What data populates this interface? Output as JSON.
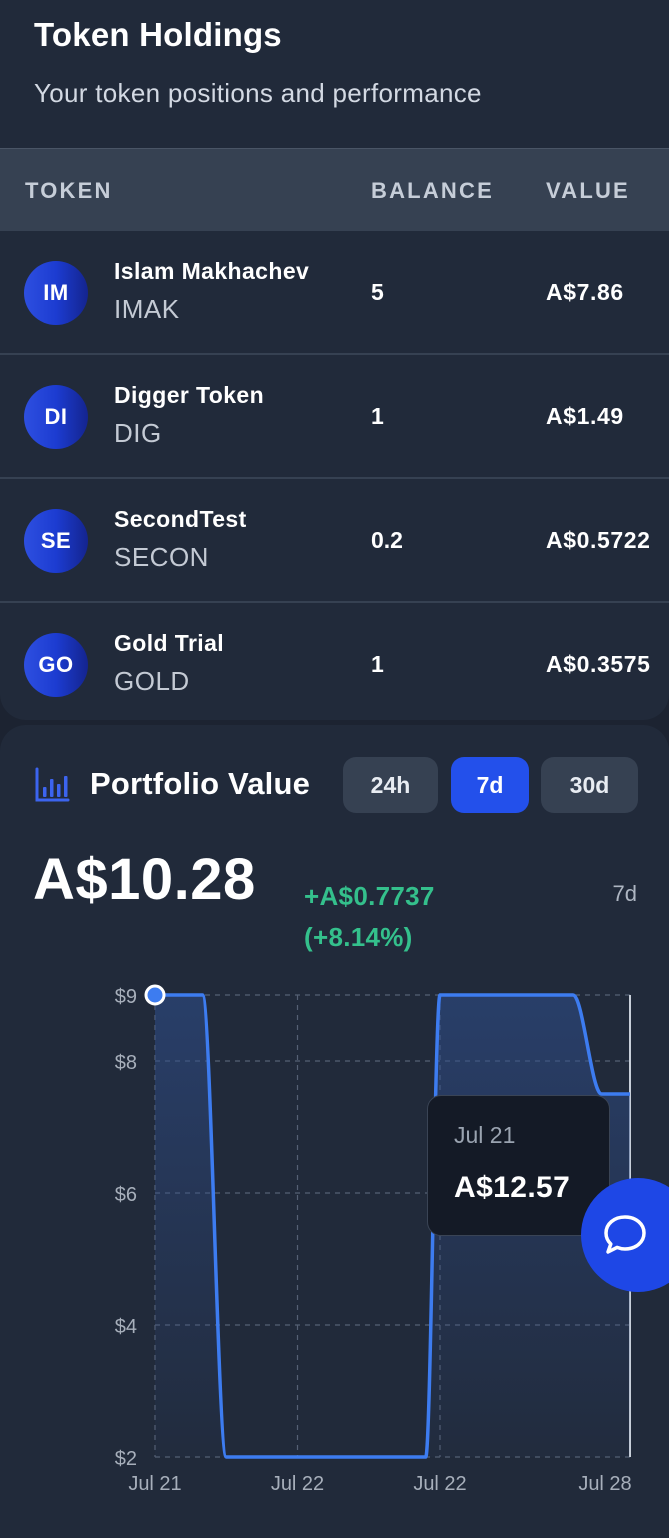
{
  "header": {
    "title": "Token Holdings",
    "subtitle": "Your token positions and performance"
  },
  "table": {
    "columns": {
      "token": "TOKEN",
      "balance": "BALANCE",
      "value": "VALUE"
    },
    "rows": [
      {
        "initials": "IM",
        "name": "Islam Makhachev",
        "symbol": "IMAK",
        "balance": "5",
        "value": "A$7.86"
      },
      {
        "initials": "DI",
        "name": "Digger Token",
        "symbol": "DIG",
        "balance": "1",
        "value": "A$1.49"
      },
      {
        "initials": "SE",
        "name": "SecondTest",
        "symbol": "SECON",
        "balance": "0.2",
        "value": "A$0.5722"
      },
      {
        "initials": "GO",
        "name": "Gold Trial",
        "symbol": "GOLD",
        "balance": "1",
        "value": "A$0.3575"
      }
    ]
  },
  "portfolio": {
    "title": "Portfolio Value",
    "icon": "bar-chart-icon",
    "ranges": [
      "24h",
      "7d",
      "30d"
    ],
    "selected_range": "7d",
    "value": "A$10.28",
    "change_amount": "+A$0.7737",
    "change_percent": "(+8.14%)",
    "period_label": "7d",
    "tooltip": {
      "date": "Jul 21",
      "value": "A$12.57"
    },
    "chat_icon": "chat-bubble-icon"
  },
  "colors": {
    "background": "#1c2331",
    "card": "#212a3a",
    "accent": "#2350eb",
    "positive": "#34c08c",
    "line": "#3d7cf0"
  },
  "chart_data": {
    "type": "area",
    "x_tick_labels": [
      "Jul 21",
      "Jul 22",
      "Jul 22",
      "Jul 28"
    ],
    "y_tick_labels": [
      "$9",
      "$8",
      "$6",
      "$4",
      "$2"
    ],
    "ylim": [
      2,
      9
    ],
    "grid": true,
    "series": [
      {
        "x": [
          0,
          0.1,
          0.15,
          0.5,
          0.57,
          0.6,
          0.65,
          0.88,
          0.94,
          1.0
        ],
        "values": [
          9.0,
          9.0,
          2.0,
          2.0,
          2.0,
          9.0,
          9.0,
          9.0,
          7.5,
          7.5
        ]
      }
    ]
  }
}
